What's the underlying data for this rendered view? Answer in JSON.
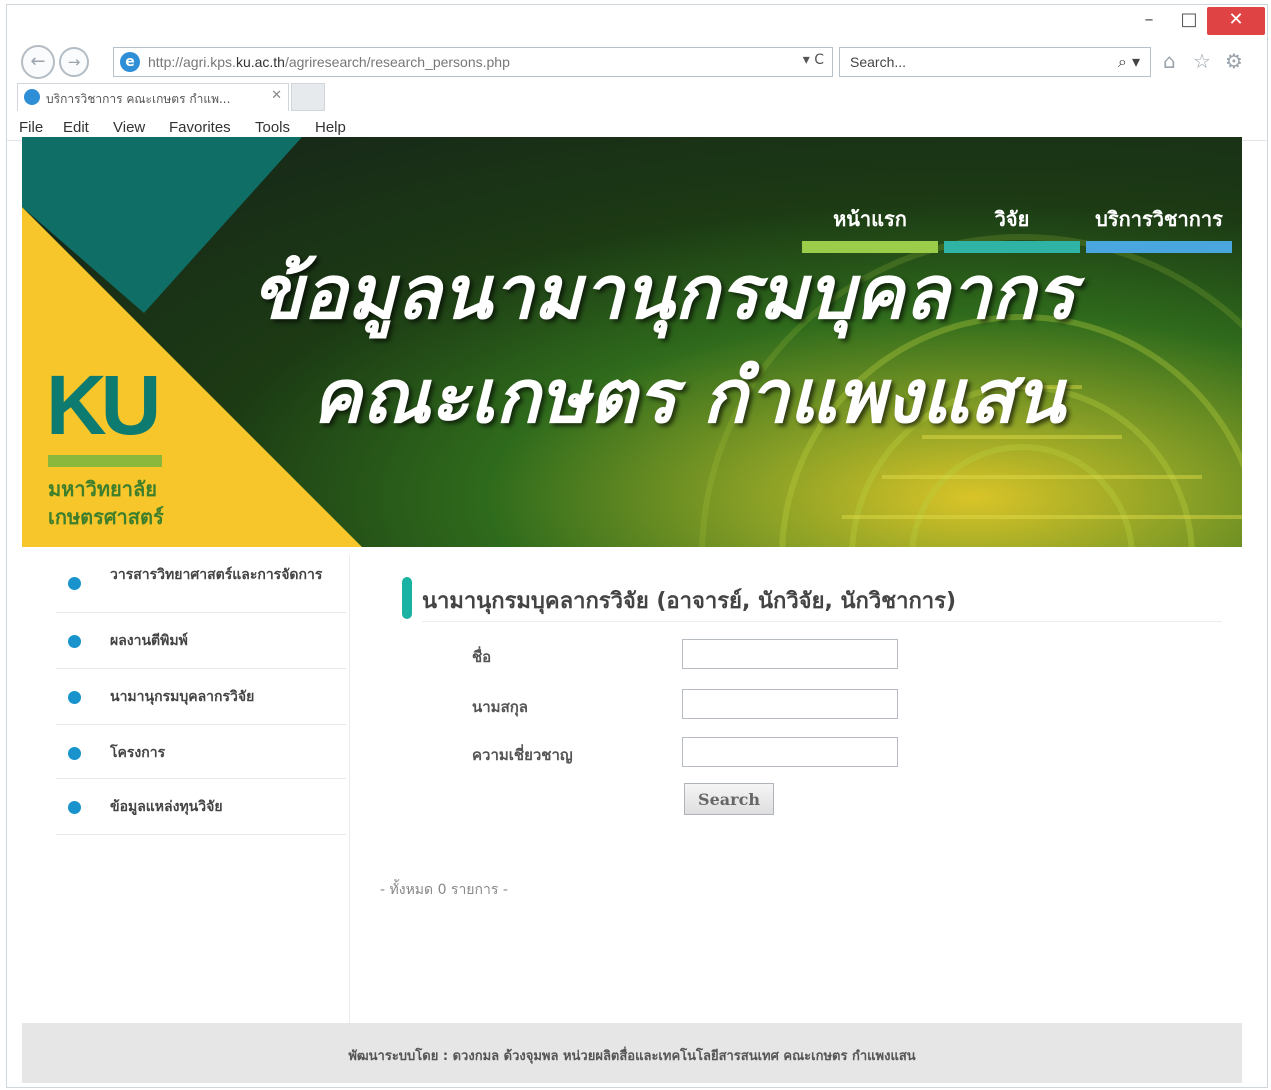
{
  "browser": {
    "window_controls": {
      "minimize": "–",
      "maximize": "□",
      "close": "✕"
    },
    "address_url_prefix": "http://agri.kps.",
    "address_url_domain": "ku.ac.th",
    "address_url_suffix": "/agriresearch/research_persons.php",
    "address_tools": "▾ C",
    "search_placeholder": "Search...",
    "search_icon": "⌕ ▾",
    "tab_title": "บริการวิชาการ คณะเกษตร กำแพ...",
    "tab_close": "✕",
    "menu": [
      "File",
      "Edit",
      "View",
      "Favorites",
      "Tools",
      "Help"
    ],
    "icons": {
      "back": "←",
      "forward": "→",
      "home": "⌂",
      "favorites": "☆",
      "settings": "⚙"
    }
  },
  "banner": {
    "logo_text": "KU",
    "logo_line1": "มหาวิทยาลัย",
    "logo_line2": "เกษตรศาสตร์",
    "nav": [
      "หน้าแรก",
      "วิจัย",
      "บริการวิชาการ"
    ],
    "title_line1": "ข้อมูลนามานุกรมบุคลากร",
    "title_line2": "คณะเกษตร กำแพงแสน",
    "colors": {
      "teal": "#0d7b6f",
      "yellow": "#f6c62b",
      "nav_green": "#9bcc4a",
      "nav_teal": "#2fb3a4",
      "nav_blue": "#4aa6de"
    }
  },
  "sidebar": {
    "items": [
      "วารสารวิทยาศาสตร์และการจัดการ",
      "ผลงานตีพิมพ์",
      "นามานุกรมบุคลากรวิจัย",
      "โครงการ",
      "ข้อมูลแหล่งทุนวิจัย"
    ]
  },
  "main": {
    "heading": "นามานุกรมบุคลากรวิจัย (อาจารย์, นักวิจัย, นักวิชาการ)",
    "fields": [
      {
        "label": "ชื่อ",
        "value": ""
      },
      {
        "label": "นามสกุล",
        "value": ""
      },
      {
        "label": "ความเชี่ยวชาญ",
        "value": ""
      }
    ],
    "search_button": "Search",
    "total_text": "- ทั้งหมด 0 รายการ -"
  },
  "footer": {
    "text": "พัฒนาระบบโดย : ดวงกมล ด้วงจุมพล หน่วยผลิตสื่อและเทคโนโลยีสารสนเทศ คณะเกษตร กำแพงแสน"
  }
}
